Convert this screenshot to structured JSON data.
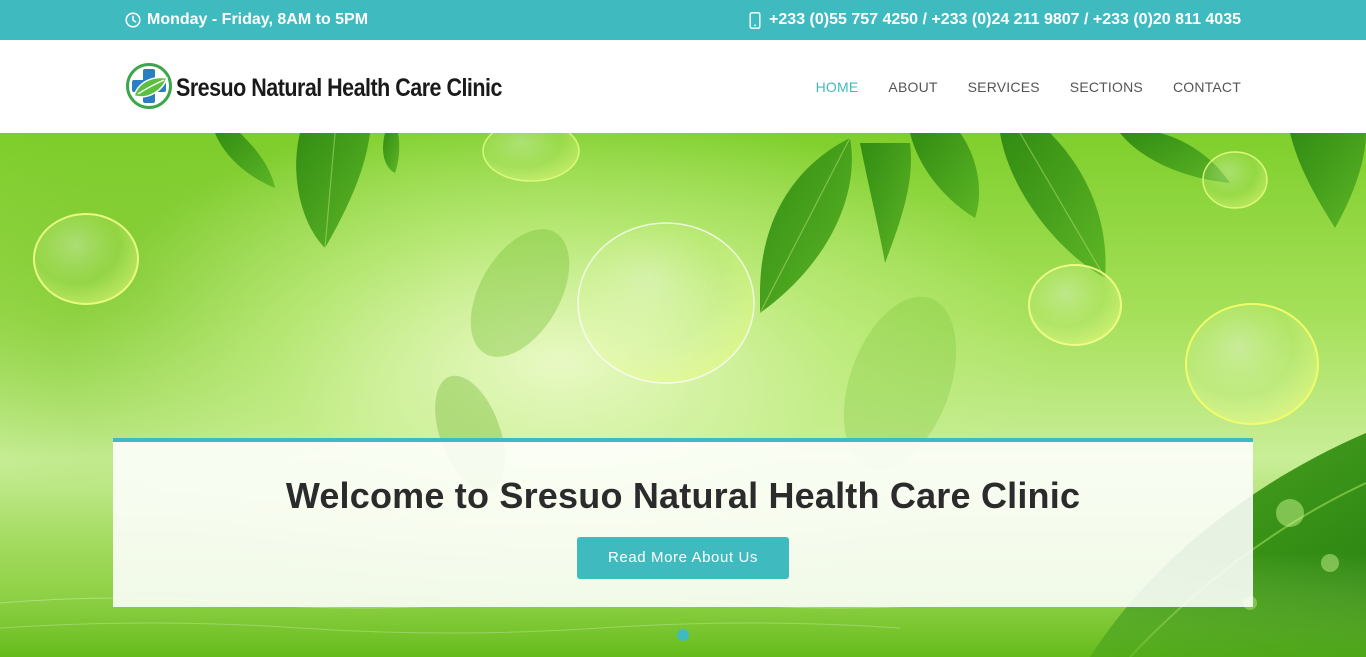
{
  "topbar": {
    "hours": "Monday - Friday, 8AM to 5PM",
    "phones": "+233 (0)55 757 4250 / +233 (0)24 211 9807 / +233 (0)20 811 4035",
    "hours_icon": "clock-icon",
    "phone_icon": "mobile-phone-icon"
  },
  "header": {
    "logo_title": "Sresuo Natural Health Care Clinic",
    "logo_icon": "cross-leaf-logo",
    "nav": [
      {
        "label": "HOME",
        "active": true
      },
      {
        "label": "ABOUT",
        "active": false
      },
      {
        "label": "SERVICES",
        "active": false
      },
      {
        "label": "SECTIONS",
        "active": false
      },
      {
        "label": "CONTACT",
        "active": false
      }
    ]
  },
  "hero": {
    "heading": "Welcome to Sresuo Natural Health Care Clinic",
    "button_label": "Read More About Us",
    "slides_count": 1,
    "active_slide": 1
  },
  "colors": {
    "accent": "#3fbbc0",
    "nav_text": "#555555",
    "heading_text": "#2b2b2b",
    "logo_green": "#3aa84a",
    "logo_blue": "#2a7fc4"
  }
}
